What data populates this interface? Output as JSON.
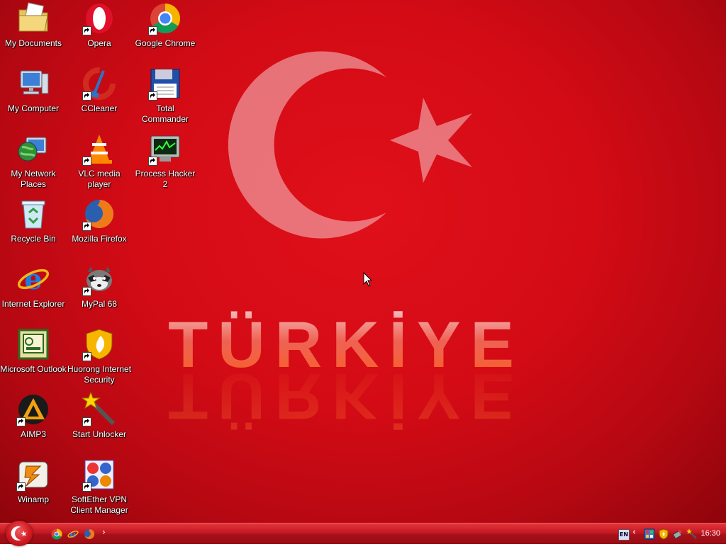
{
  "wallpaper": {
    "title": "TÜRKİYE",
    "background_color": "#d30b15",
    "emblem": "crescent-and-star"
  },
  "desktop": {
    "icons": [
      {
        "label": "My Documents",
        "icon": "folder-documents-icon",
        "shortcut": false
      },
      {
        "label": "My Computer",
        "icon": "computer-icon",
        "shortcut": false
      },
      {
        "label": "My Network Places",
        "icon": "network-places-icon",
        "shortcut": false
      },
      {
        "label": "Recycle Bin",
        "icon": "recycle-bin-icon",
        "shortcut": false
      },
      {
        "label": "Internet Explorer",
        "icon": "internet-explorer-icon",
        "shortcut": false
      },
      {
        "label": "Microsoft Outlook",
        "icon": "outlook-icon",
        "shortcut": false
      },
      {
        "label": "AIMP3",
        "icon": "aimp-icon",
        "shortcut": true
      },
      {
        "label": "Winamp",
        "icon": "winamp-icon",
        "shortcut": true
      },
      {
        "label": "Opera",
        "icon": "opera-icon",
        "shortcut": true
      },
      {
        "label": "CCleaner",
        "icon": "ccleaner-icon",
        "shortcut": true
      },
      {
        "label": "VLC media player",
        "icon": "vlc-icon",
        "shortcut": true
      },
      {
        "label": "Mozilla Firefox",
        "icon": "firefox-icon",
        "shortcut": true
      },
      {
        "label": "MyPal 68",
        "icon": "mypal-icon",
        "shortcut": true
      },
      {
        "label": "Huorong Internet Security",
        "icon": "huorong-icon",
        "shortcut": true
      },
      {
        "label": "Start Unlocker",
        "icon": "unlocker-wand-icon",
        "shortcut": true
      },
      {
        "label": "SoftEther VPN Client Manager",
        "icon": "softether-vpn-icon",
        "shortcut": true
      },
      {
        "label": "Google Chrome",
        "icon": "chrome-icon",
        "shortcut": true
      },
      {
        "label": "Total Commander",
        "icon": "total-commander-icon",
        "shortcut": true
      },
      {
        "label": "Process Hacker 2",
        "icon": "process-hacker-icon",
        "shortcut": true
      }
    ]
  },
  "taskbar": {
    "start_icon": "turkish-flag-start-icon",
    "quick_launch": [
      {
        "icon": "chrome-icon"
      },
      {
        "icon": "internet-explorer-icon"
      },
      {
        "icon": "firefox-icon"
      }
    ],
    "quick_launch_more": "›",
    "tray": {
      "language": "EN",
      "chevron": "‹",
      "icons": [
        "network-icon",
        "huorong-shield-icon",
        "usb-device-icon",
        "unlocker-wand-icon"
      ],
      "clock": "16:30"
    }
  }
}
